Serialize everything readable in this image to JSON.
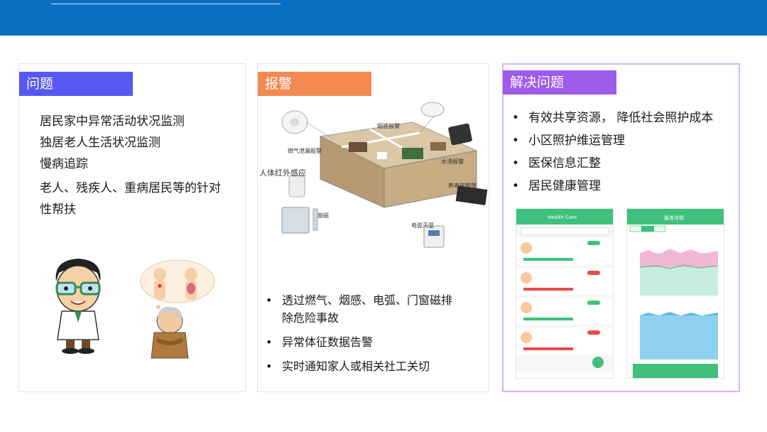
{
  "cards": {
    "problem": {
      "title": "问题",
      "items": [
        "居民家中异常活动状况监测",
        "独居老人生活状况监测",
        "慢病追踪",
        "老人、残疾人、重病居民等的针对",
        "性帮扶"
      ]
    },
    "alarm": {
      "title": "报警",
      "diagram_labels": {
        "smoke": "烟感报警",
        "gas": "燃气泄漏报警",
        "water": "水浸报警",
        "infrared": "人体红外感应",
        "bed": "养老床脚垫",
        "door": "窗磁",
        "arc": "电弧灭弧"
      },
      "bullet": "•",
      "items": [
        "透过燃气、烟感、电弧、门窗磁排",
        "除危险事故",
        "异常体征数据告警",
        "实时通知家人或相关社工关切"
      ]
    },
    "solution": {
      "title": "解决问题",
      "bullet": "•",
      "items": [
        "有效共享资源， 降低社会照护成本",
        "小区照护维运管理",
        "医保信息汇整",
        "居民健康管理"
      ],
      "phone1_title": "Health Care",
      "phone2_title": "服务详情"
    }
  },
  "colors": {
    "top_bar": "#0a6ec2",
    "problem_tag": "#5758f2",
    "alarm_tag": "#f28a52",
    "solution_tag": "#9d5bea",
    "app_green": "#3fc07d"
  }
}
